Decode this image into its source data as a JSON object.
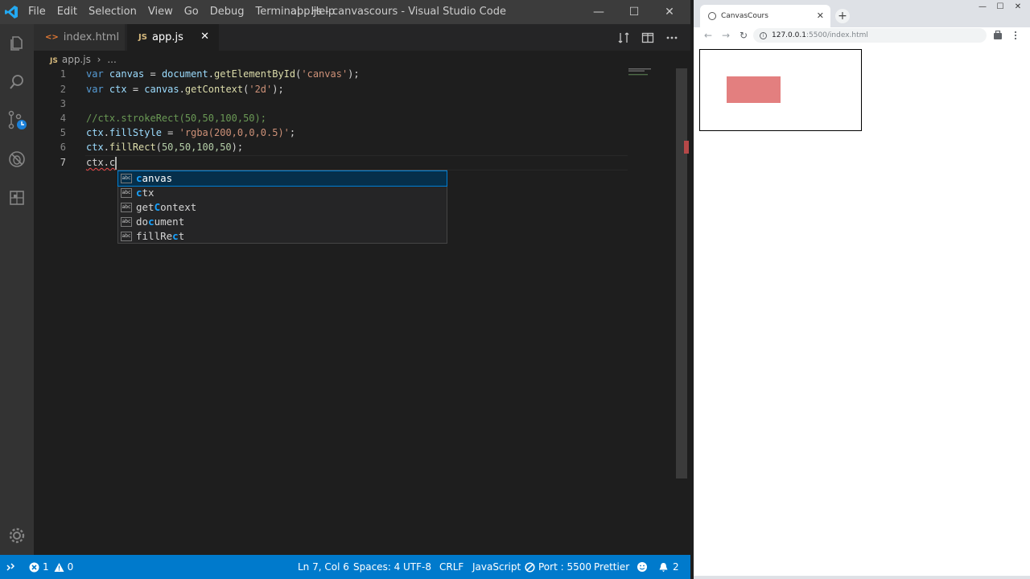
{
  "vscode": {
    "menu": [
      "File",
      "Edit",
      "Selection",
      "View",
      "Go",
      "Debug",
      "Terminal",
      "Help"
    ],
    "window_title": "app.js - canvascours - Visual Studio Code",
    "window_controls": {
      "minimize": "—",
      "maximize": "☐",
      "close": "✕"
    },
    "tabs": [
      {
        "label": "index.html",
        "icon": "<>",
        "active": false
      },
      {
        "label": "app.js",
        "icon": "JS",
        "active": true,
        "close": "✕"
      }
    ],
    "breadcrumb": {
      "file": "app.js",
      "icon": "JS",
      "sep": "›",
      "more": "..."
    },
    "line_numbers": [
      "1",
      "2",
      "3",
      "4",
      "5",
      "6",
      "7"
    ],
    "code": {
      "line1": {
        "kw": "var",
        "name": " canvas",
        "eq": " = ",
        "obj": "document",
        "dot": ".",
        "fn": "getElementById",
        "open": "(",
        "str": "'canvas'",
        "close": ");"
      },
      "line2": {
        "kw": "var",
        "name": " ctx",
        "eq": " = ",
        "obj": "canvas",
        "dot": ".",
        "fn": "getContext",
        "open": "(",
        "str": "'2d'",
        "close": ");"
      },
      "line4": {
        "comment": "//ctx.strokeRect(50,50,100,50);"
      },
      "line5": {
        "obj": "ctx",
        "dot": ".",
        "prop": "fillStyle",
        "eq": " = ",
        "str": "'rgba(200,0,0,0.5)'",
        "end": ";"
      },
      "line6": {
        "obj": "ctx",
        "dot": ".",
        "fn": "fillRect",
        "open": "(",
        "args": "50,50,100,50",
        "close": ");"
      },
      "line7": {
        "text": "ctx.c"
      }
    },
    "suggestions": [
      {
        "pre": "",
        "hl": "c",
        "post": "anvas",
        "selected": true
      },
      {
        "pre": "",
        "hl": "c",
        "post": "tx",
        "selected": false
      },
      {
        "pre": "get",
        "hl": "C",
        "post": "ontext",
        "selected": false
      },
      {
        "pre": "do",
        "hl": "c",
        "post": "ument",
        "selected": false
      },
      {
        "pre": "fillRe",
        "hl": "c",
        "post": "t",
        "selected": false
      }
    ],
    "suggest_icon": "abc",
    "status": {
      "errors": "1",
      "warnings": "0",
      "position": "Ln 7, Col 6",
      "spaces": "Spaces: 4",
      "encoding": "UTF-8",
      "eol": "CRLF",
      "language": "JavaScript",
      "port": "Port : 5500",
      "formatter": "Prettier",
      "notifications": "2"
    },
    "colors": {
      "accent": "#007acc",
      "selection": "#062f4a",
      "highlight": "#18a3ff"
    }
  },
  "browser": {
    "tab_title": "CanvasCours",
    "tab_close": "✕",
    "new_tab": "+",
    "window_controls": {
      "minimize": "—",
      "maximize": "☐",
      "close": "✕"
    },
    "nav": {
      "back": "←",
      "forward": "→",
      "reload": "↻"
    },
    "url_host": "127.0.0.1",
    "url_rest": ":5500/index.html",
    "info_icon": "i",
    "rect_color": "rgba(200,0,0,0.5)"
  }
}
